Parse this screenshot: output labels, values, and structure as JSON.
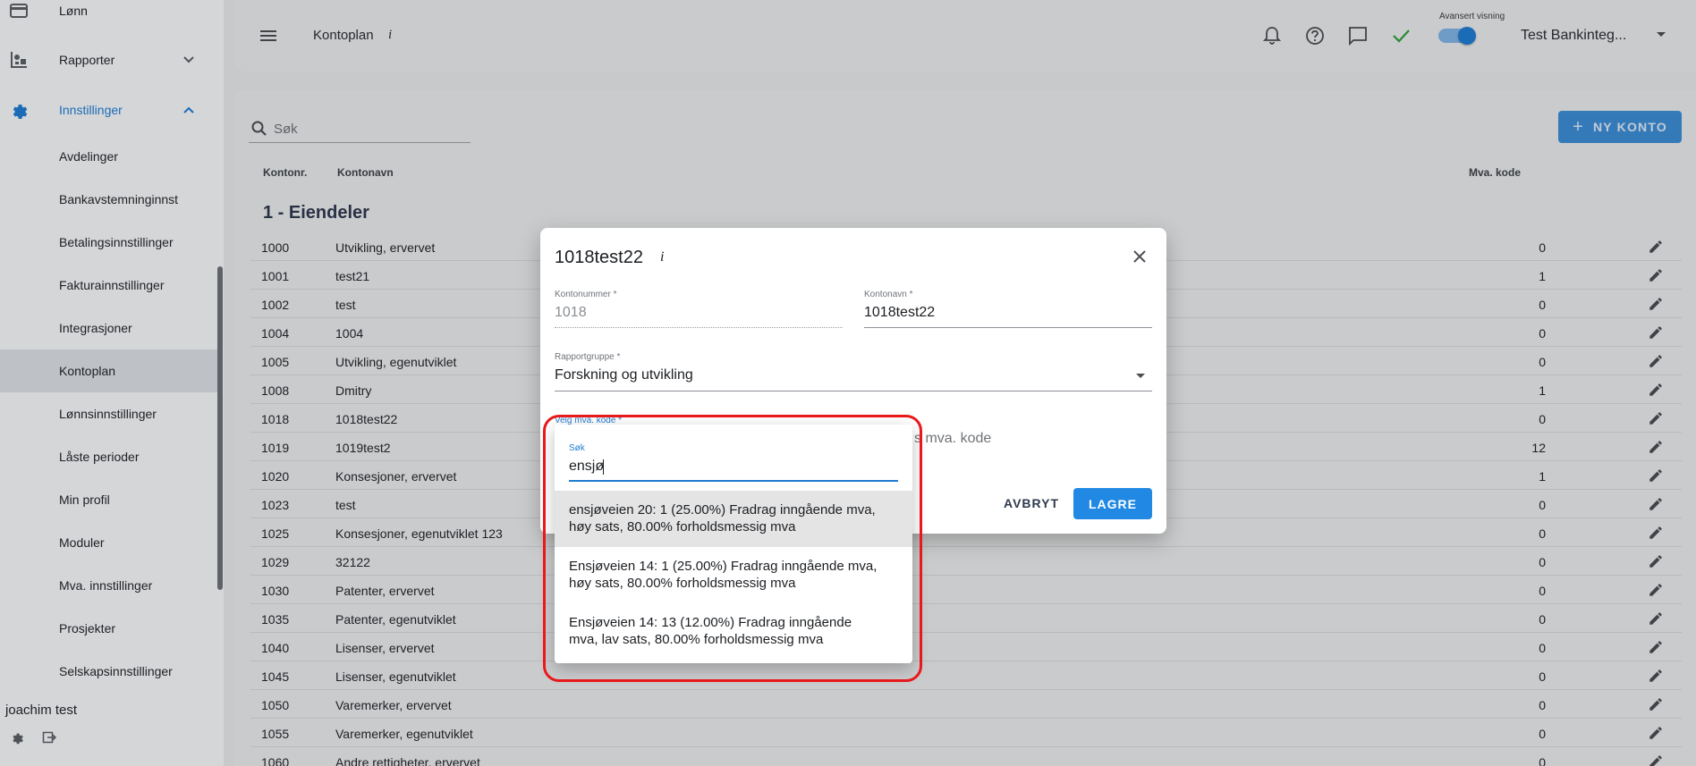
{
  "sidebar": {
    "items": [
      {
        "label": "Lønn",
        "icon": "wallet-icon"
      },
      {
        "label": "Rapporter",
        "icon": "reports-icon",
        "expand": "chevron-down"
      },
      {
        "label": "Innstillinger",
        "icon": "gear-icon",
        "expand": "chevron-up",
        "active": true
      },
      {
        "label": "Avdelinger"
      },
      {
        "label": "Bankavstemninginnst"
      },
      {
        "label": "Betalingsinnstillinger"
      },
      {
        "label": "Fakturainnstillinger"
      },
      {
        "label": "Integrasjoner"
      },
      {
        "label": "Kontoplan",
        "selected": true
      },
      {
        "label": "Lønnsinnstillinger"
      },
      {
        "label": "Låste perioder"
      },
      {
        "label": "Min profil"
      },
      {
        "label": "Moduler"
      },
      {
        "label": "Mva. innstillinger"
      },
      {
        "label": "Prosjekter"
      },
      {
        "label": "Selskapsinnstillinger"
      }
    ],
    "user_name": "joachim test"
  },
  "topbar": {
    "title": "Kontoplan",
    "title_info": "i",
    "advanced_view_label": "Avansert visning",
    "company": "Test Bankinteg...",
    "icons": [
      "bell-icon",
      "help-icon",
      "chat-icon",
      "check-icon"
    ]
  },
  "main": {
    "search_placeholder": "Søk",
    "new_account_button": "NY KONTO",
    "columns": {
      "number": "Kontonr.",
      "name": "Kontonavn",
      "vat": "Mva. kode"
    },
    "group_title": "1 - Eiendeler",
    "rows": [
      {
        "number": "1000",
        "name": "Utvikling, ervervet",
        "vat": "0"
      },
      {
        "number": "1001",
        "name": "test21",
        "vat": "1"
      },
      {
        "number": "1002",
        "name": "test",
        "vat": "0"
      },
      {
        "number": "1004",
        "name": "1004",
        "vat": "0"
      },
      {
        "number": "1005",
        "name": "Utvikling, egenutviklet",
        "vat": "0"
      },
      {
        "number": "1008",
        "name": "Dmitry",
        "vat": "1"
      },
      {
        "number": "1018",
        "name": "1018test22",
        "vat": "0"
      },
      {
        "number": "1019",
        "name": "1019test2",
        "vat": "12"
      },
      {
        "number": "1020",
        "name": "Konsesjoner, ervervet",
        "vat": "1"
      },
      {
        "number": "1023",
        "name": "test",
        "vat": "0"
      },
      {
        "number": "1025",
        "name": "Konsesjoner, egenutviklet 123",
        "vat": "0"
      },
      {
        "number": "1029",
        "name": "32122",
        "vat": "0"
      },
      {
        "number": "1030",
        "name": "Patenter, ervervet",
        "vat": "0"
      },
      {
        "number": "1035",
        "name": "Patenter, egenutviklet",
        "vat": "0"
      },
      {
        "number": "1040",
        "name": "Lisenser, ervervet",
        "vat": "0"
      },
      {
        "number": "1045",
        "name": "Lisenser, egenutviklet",
        "vat": "0"
      },
      {
        "number": "1050",
        "name": "Varemerker, ervervet",
        "vat": "0"
      },
      {
        "number": "1055",
        "name": "Varemerker, egenutviklet",
        "vat": "0"
      },
      {
        "number": "1060",
        "name": "Andre rettigheter, ervervet",
        "vat": "0"
      }
    ]
  },
  "dialog": {
    "title": "1018test22",
    "title_info": "i",
    "account_number_label": "Kontonummer *",
    "account_number_value": "1018",
    "account_name_label": "Kontonavn *",
    "account_name_value": "1018test22",
    "report_group_label": "Rapportgruppe *",
    "report_group_value": "Forskning og utvikling",
    "vat_code_label": "Velg mva. kode *",
    "vat_hint": "s mva. kode",
    "cancel_button": "AVBRYT",
    "save_button": "LAGRE"
  },
  "vat_dropdown": {
    "search_label": "Søk",
    "search_value": "ensjø",
    "options": [
      {
        "line1": "ensjøveien 20: 1 (25.00%) Fradrag inngående mva,",
        "line2": "høy sats, 80.00% forholdsmessig mva",
        "highlighted": true
      },
      {
        "line1": "Ensjøveien 14: 1 (25.00%) Fradrag inngående mva,",
        "line2": "høy sats, 80.00% forholdsmessig mva"
      },
      {
        "line1": "Ensjøveien 14: 13 (12.00%) Fradrag inngående",
        "line2": "mva, lav sats, 80.00% forholdsmessig mva"
      }
    ]
  },
  "colors": {
    "accent": "#1f7bd0",
    "save_button": "#2189e3",
    "annotation_red": "#e8181b",
    "success_check": "#2e9d3a"
  }
}
